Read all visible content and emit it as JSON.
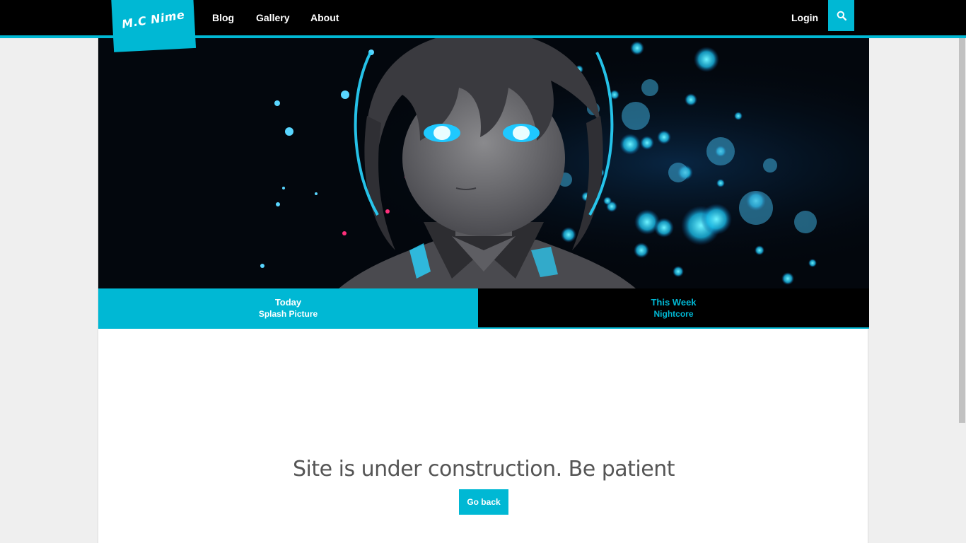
{
  "header": {
    "logo_text": "M.C Nime",
    "nav": [
      {
        "label": "Blog"
      },
      {
        "label": "Gallery"
      },
      {
        "label": "About"
      }
    ],
    "login_label": "Login",
    "search_icon": "search-icon"
  },
  "tabs": [
    {
      "title": "Today",
      "subtitle": "Splash Picture"
    },
    {
      "title": "This Week",
      "subtitle": "Nightcore"
    }
  ],
  "content": {
    "message": "Site is under construction. Be patient",
    "button_label": "Go back"
  },
  "colors": {
    "accent": "#00b8d4",
    "topbar": "#000000",
    "page_bg": "#efefef"
  }
}
